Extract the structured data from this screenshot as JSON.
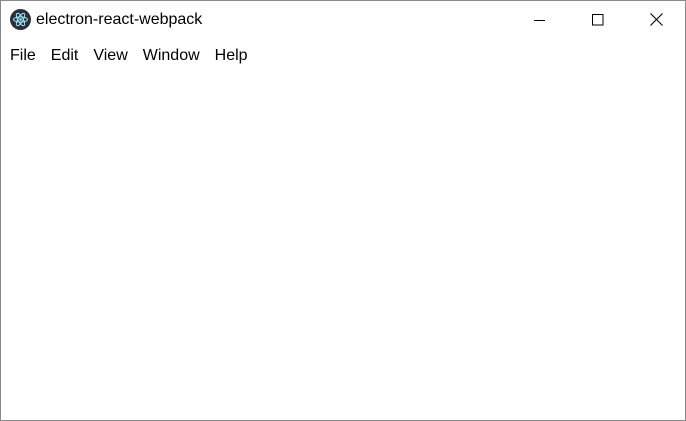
{
  "window": {
    "title": "electron-react-webpack",
    "app_icon": "electron-icon"
  },
  "titlebar_controls": [
    {
      "name": "minimize",
      "icon": "minimize-icon"
    },
    {
      "name": "maximize",
      "icon": "maximize-icon"
    },
    {
      "name": "close",
      "icon": "close-icon"
    }
  ],
  "menubar": {
    "items": [
      {
        "label": "File"
      },
      {
        "label": "Edit"
      },
      {
        "label": "View"
      },
      {
        "label": "Window"
      },
      {
        "label": "Help"
      }
    ]
  }
}
